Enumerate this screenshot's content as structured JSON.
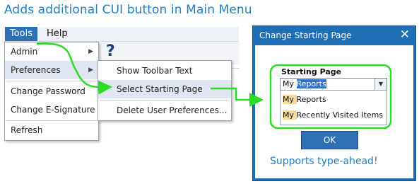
{
  "title": "Adds additional CUI button in Main Menu",
  "menubar": {
    "tools": "Tools",
    "help": "Help"
  },
  "tools_menu": {
    "items": [
      {
        "label": "Admin",
        "has_submenu": true
      },
      {
        "label": "Preferences",
        "has_submenu": true
      },
      {
        "label": "Change Password",
        "has_submenu": false
      },
      {
        "label": "Change E-Signature",
        "has_submenu": false
      },
      {
        "label": "Refresh",
        "has_submenu": false
      }
    ]
  },
  "submenu": {
    "items": [
      {
        "label": "Show Toolbar Text"
      },
      {
        "label": "Select Starting Page"
      },
      {
        "label": "Delete User Preferences..."
      }
    ]
  },
  "toolbar": {
    "help_glyph": "?"
  },
  "dialog": {
    "title": "Change Starting Page",
    "close_glyph": "✕",
    "field_label": "Starting Page",
    "input_typed": "My ",
    "input_autocomplete": "Reports",
    "options": [
      {
        "match": "My ",
        "rest": "Reports"
      },
      {
        "match": "My ",
        "rest": "Recently Visited Items"
      }
    ],
    "ok_label": "OK"
  },
  "note": "Supports type-ahead!",
  "colors": {
    "accent": "#1e7fc8",
    "highlight_green": "#2bdc25",
    "dialog_blue": "#1e6fb5"
  }
}
